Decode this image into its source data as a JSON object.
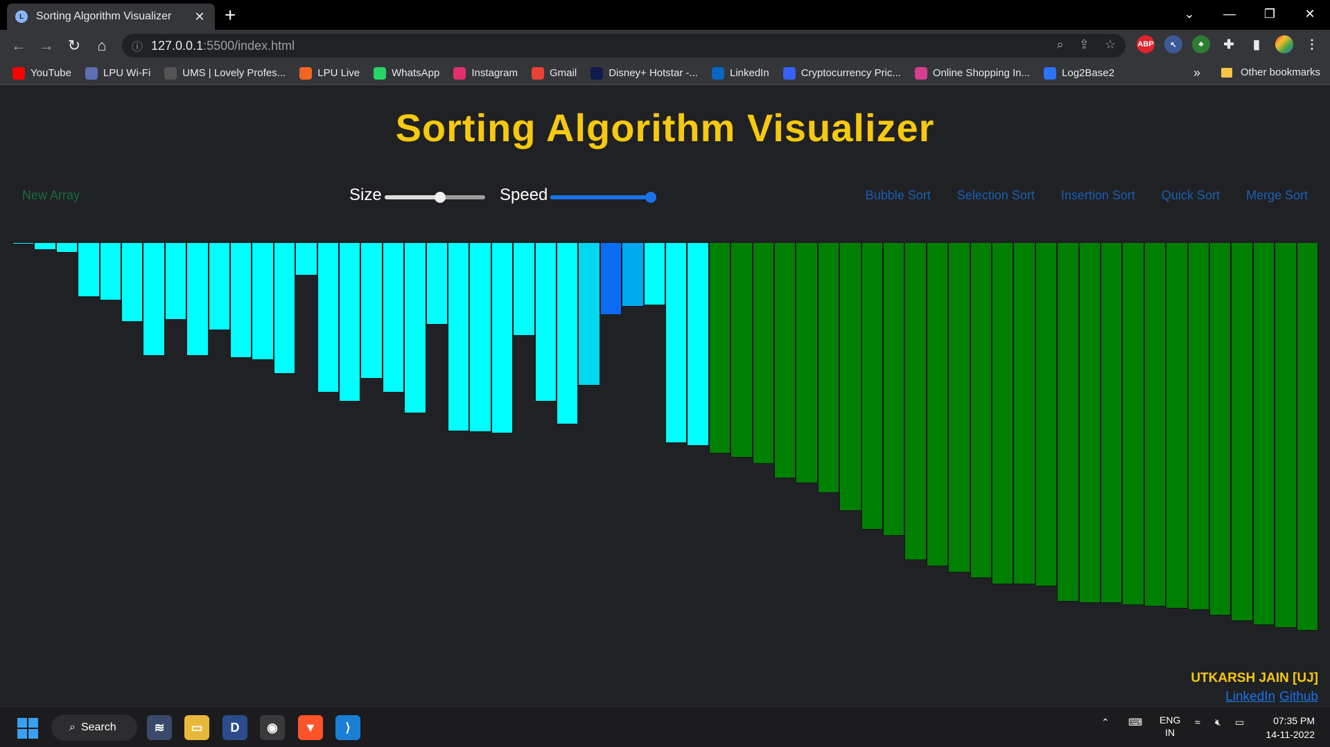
{
  "browser": {
    "tab_title": "Sorting Algorithm Visualizer",
    "url_host": "127.0.0.1",
    "url_path": ":5500/index.html",
    "bookmarks": [
      {
        "label": "YouTube",
        "color": "#ff0000"
      },
      {
        "label": "LPU Wi-Fi",
        "color": "#5f6fb3"
      },
      {
        "label": "UMS | Lovely Profes...",
        "color": "#555"
      },
      {
        "label": "LPU Live",
        "color": "#f26522"
      },
      {
        "label": "WhatsApp",
        "color": "#25d366"
      },
      {
        "label": "Instagram",
        "color": "#e1306c"
      },
      {
        "label": "Gmail",
        "color": "#ea4335"
      },
      {
        "label": "Disney+ Hotstar -...",
        "color": "#0f1b4c"
      },
      {
        "label": "LinkedIn",
        "color": "#0a66c2"
      },
      {
        "label": "Cryptocurrency Pric...",
        "color": "#3861fb"
      },
      {
        "label": "Online Shopping In...",
        "color": "#d23f8f"
      },
      {
        "label": "Log2Base2",
        "color": "#2a74f5"
      }
    ],
    "bookmarks_more": "»",
    "other_bookmarks": "Other bookmarks"
  },
  "page": {
    "title": "Sorting Algorithm Visualizer",
    "new_array": "New Array",
    "size_label": "Size",
    "speed_label": "Speed",
    "size_value": 0.55,
    "speed_value": 1.0,
    "algorithms": [
      "Bubble Sort",
      "Selection Sort",
      "Insertion Sort",
      "Quick Sort",
      "Merge Sort"
    ],
    "author": "UTKARSH JAIN [UJ]",
    "links": [
      "LinkedIn",
      "Github"
    ]
  },
  "colors": {
    "unsorted": "#00ffff",
    "compare": "#00d8f0",
    "active": "#0a6cf5",
    "pivot": "#00aaf0",
    "sorted": "#008000",
    "title": "#f6c90e"
  },
  "bars": {
    "values": [
      2,
      10,
      14,
      78,
      83,
      114,
      163,
      111,
      163,
      126,
      166,
      169,
      189,
      47,
      216,
      229,
      196,
      216,
      246,
      118,
      272,
      273,
      275,
      134,
      229,
      262,
      206,
      104,
      92,
      90,
      289,
      293,
      304,
      310,
      319,
      340,
      347,
      361,
      387,
      414,
      423,
      458,
      467,
      476,
      484,
      493,
      493,
      496,
      518,
      520,
      520,
      523,
      525,
      528,
      530,
      538,
      546,
      552,
      556,
      560
    ],
    "states": [
      "u",
      "u",
      "u",
      "u",
      "u",
      "u",
      "u",
      "u",
      "u",
      "u",
      "u",
      "u",
      "u",
      "u",
      "u",
      "u",
      "u",
      "u",
      "u",
      "u",
      "u",
      "u",
      "u",
      "u",
      "u",
      "u",
      "c",
      "a",
      "p",
      "u",
      "u",
      "u",
      "s",
      "s",
      "s",
      "s",
      "s",
      "s",
      "s",
      "s",
      "s",
      "s",
      "s",
      "s",
      "s",
      "s",
      "s",
      "s",
      "s",
      "s",
      "s",
      "s",
      "s",
      "s",
      "s",
      "s",
      "s",
      "s",
      "s",
      "s"
    ]
  },
  "taskbar": {
    "search": "Search",
    "lang1": "ENG",
    "lang2": "IN",
    "time": "07:35 PM",
    "date": "14-11-2022"
  }
}
